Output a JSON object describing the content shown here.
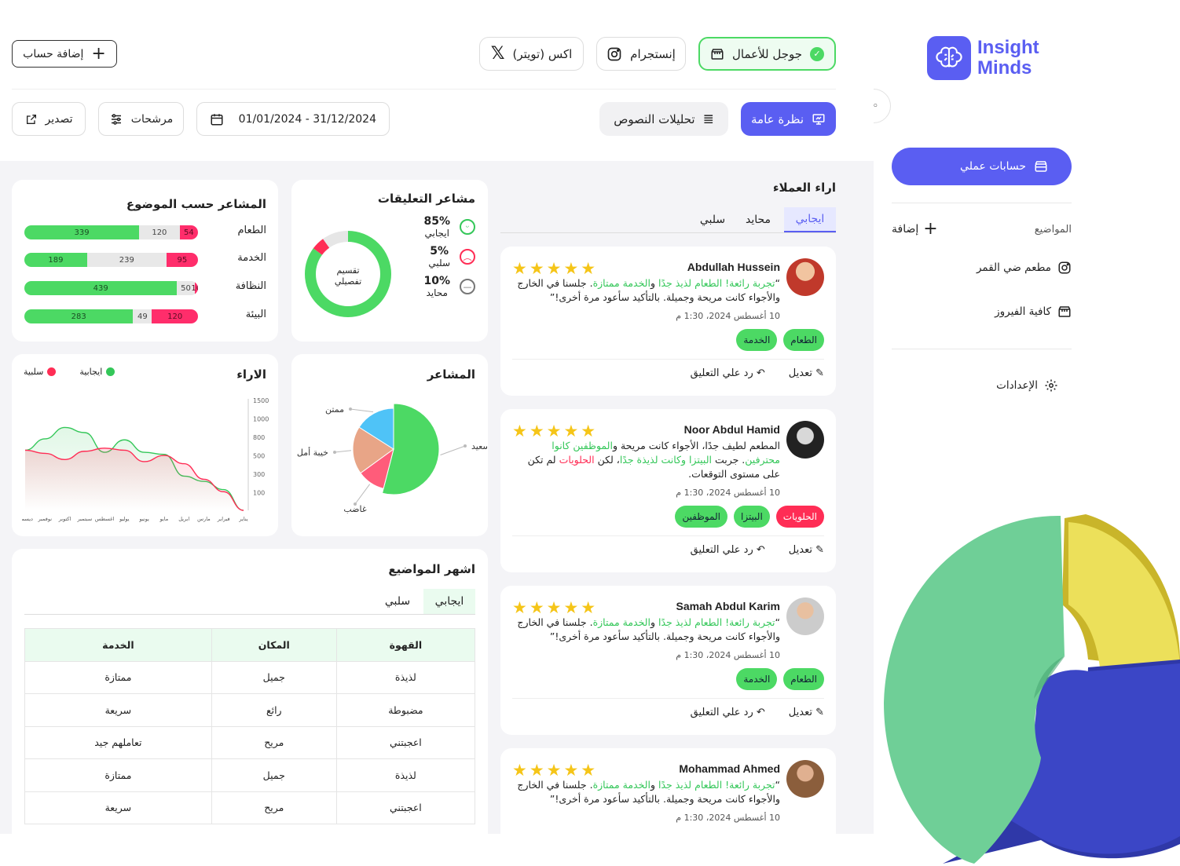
{
  "brand": {
    "line1": "Insight",
    "line2": "Minds"
  },
  "collapse_label": "|◦",
  "sidebar": {
    "primary_button": "حسابات عملي",
    "topics_label": "المواضيع",
    "add_label": "إضافة",
    "items": [
      {
        "label": "مطعم ضي القمر"
      },
      {
        "label": "كافية الفيروز"
      }
    ],
    "settings": "الإعدادات"
  },
  "platforms": [
    {
      "label": "جوجل للأعمال"
    },
    {
      "label": "إنستجرام"
    },
    {
      "label": "اكس (تويتر)"
    }
  ],
  "add_account": "إضافة حساب",
  "toolbar": {
    "overview": "نظرة عامة",
    "text_analytics": "تحليلات النصوص",
    "date_range": "01/01/2024 - 31/12/2024",
    "filters": "مرشحات",
    "export": "تصدير"
  },
  "reviews_panel": {
    "title": "اراء العملاء",
    "tabs": [
      "ايجابي",
      "محايد",
      "سلبي"
    ],
    "edit": "تعديل",
    "reply": "رد علي التعليق",
    "reviews": [
      {
        "name": "Abdullah Hussein",
        "date": "10 أغسطس 2024، 1:30 م",
        "tags": [
          "الطعام",
          "الخدمة"
        ]
      },
      {
        "name": "Noor Abdul Hamid",
        "date": "10 أغسطس 2024، 1:30 م",
        "tags": [
          "الحلويات",
          "البيتزا",
          "الموظفين"
        ]
      },
      {
        "name": "Samah Abdul Karim",
        "date": "10 أغسطس 2024، 1:30 م",
        "tags": [
          "الطعام",
          "الخدمة"
        ]
      },
      {
        "name": "Mohammad Ahmed",
        "date": "10 أغسطس 2024، 1:30 م",
        "tags": []
      }
    ]
  },
  "comment_sentiment": {
    "title": "مشاعر التعليقات",
    "center": [
      "تقسيم",
      "تفصيلي"
    ],
    "items": [
      {
        "pct": "85%",
        "label": "ايجابي",
        "value": 85,
        "color": "#4cd964",
        "icon": "smile-icon"
      },
      {
        "pct": "5%",
        "label": "سلبي",
        "value": 5,
        "color": "#ff2d55",
        "icon": "sad-icon"
      },
      {
        "pct": "10%",
        "label": "محايد",
        "value": 10,
        "color": "#e6e6e6",
        "icon": "neutral-icon"
      }
    ]
  },
  "topic_sentiment": {
    "title": "المشاعر حسب الموضوع",
    "rows": [
      {
        "label": "الطعام",
        "pos": 339,
        "neu": 120,
        "neg": 54
      },
      {
        "label": "الخدمة",
        "pos": 189,
        "neu": 239,
        "neg": 95
      },
      {
        "label": "النظافة",
        "pos": 439,
        "neu": 50,
        "neg": 10
      },
      {
        "label": "البيئة",
        "pos": 283,
        "neu": 49,
        "neg": 120
      }
    ]
  },
  "emotions": {
    "title": "المشاعر",
    "slices": [
      {
        "label": "سعيد",
        "value": 54,
        "color": "#4cd964"
      },
      {
        "label": "غاضب",
        "value": 11,
        "color": "#ff5c7a"
      },
      {
        "label": "خيبة أمل",
        "value": 19,
        "color": "#e8a587"
      },
      {
        "label": "ممتن",
        "value": 16,
        "color": "#4fc3f7"
      }
    ]
  },
  "chart_data": {
    "type": "line",
    "title": "الاراء",
    "x": [
      "يناير",
      "فبراير",
      "مارس",
      "ابريل",
      "مايو",
      "يونيو",
      "يوليو",
      "اغسطس",
      "سبتمبر",
      "اكتوبر",
      "نوفمبر",
      "ديسمبر"
    ],
    "yticks": [
      "1500",
      "1000",
      "800",
      "500",
      "300",
      "100"
    ],
    "series": [
      {
        "name": "ايجابية",
        "color": "#34c759",
        "values": [
          580,
          690,
          800,
          750,
          560,
          680,
          560,
          540,
          330,
          280,
          200,
          0
        ]
      },
      {
        "name": "سلبية",
        "color": "#ff2d55",
        "values": [
          580,
          550,
          490,
          570,
          600,
          580,
          470,
          530,
          450,
          300,
          180,
          0
        ]
      }
    ],
    "legend": "top"
  },
  "top_topics": {
    "title": "اشهر المواضيع",
    "tabs": [
      "ايجابي",
      "سلبي"
    ],
    "headers": [
      "القهوة",
      "المكان",
      "الخدمة"
    ],
    "rows": [
      [
        "لذيذة",
        "جميل",
        "ممتازة"
      ],
      [
        "مضبوطة",
        "رائع",
        "سريعة"
      ],
      [
        "اعجبتني",
        "مريح",
        "تعاملهم جيد"
      ],
      [
        "لذيذة",
        "جميل",
        "ممتازة"
      ],
      [
        "اعجبتني",
        "مريح",
        "سريعة"
      ]
    ]
  }
}
